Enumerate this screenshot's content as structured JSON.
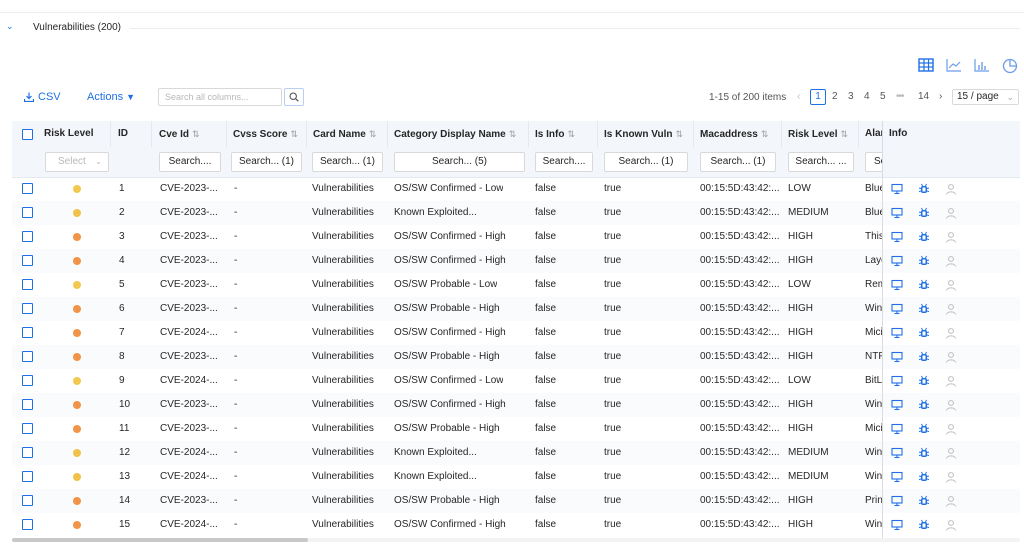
{
  "section": {
    "title": "Vulnerabilities (200)"
  },
  "view_icons": [
    "table-icon",
    "line-chart-icon",
    "bar-chart-icon",
    "pie-chart-icon"
  ],
  "toolbar": {
    "csv_label": "CSV",
    "actions_label": "Actions",
    "search_placeholder": "Search all columns...",
    "range_text": "1-15 of 200 items",
    "pages": [
      "1",
      "2",
      "3",
      "4",
      "5",
      "•••",
      "14"
    ],
    "active_page": "1",
    "page_size": "15 / page"
  },
  "colors": {
    "accent": "#1f6fe5",
    "low": "#f2c94c",
    "high": "#f0944a",
    "medium": "#f0c24a"
  },
  "columns": [
    "Risk Level",
    "ID",
    "Cve Id",
    "Cvss Score",
    "Card Name",
    "Category Display Name",
    "Is Info",
    "Is Known Vuln",
    "Macaddress",
    "Risk Level",
    "Alar",
    "Info"
  ],
  "filters": [
    "Select",
    "Search....",
    "Search... (1)",
    "Search... (1)",
    "Search... (5)",
    "Search....",
    "Search... (1)",
    "Search... (1)",
    "Search... ...",
    "Se"
  ],
  "rows": [
    {
      "id": "1",
      "cve": "CVE-2023-...",
      "cvss": "-",
      "card": "Vulnerabilities",
      "category": "OS/SW Confirmed - Low",
      "info": "false",
      "known": "true",
      "mac": "00:15:5D:43:42:...",
      "risk": "LOW",
      "alarm": "Blue",
      "dot": "low"
    },
    {
      "id": "2",
      "cve": "CVE-2023-...",
      "cvss": "-",
      "card": "Vulnerabilities",
      "category": "Known Exploited...",
      "info": "false",
      "known": "true",
      "mac": "00:15:5D:43:42:...",
      "risk": "MEDIUM",
      "alarm": "Blue",
      "dot": "medium"
    },
    {
      "id": "3",
      "cve": "CVE-2023-...",
      "cvss": "-",
      "card": "Vulnerabilities",
      "category": "OS/SW Confirmed - High",
      "info": "false",
      "known": "true",
      "mac": "00:15:5D:43:42:...",
      "risk": "HIGH",
      "alarm": "This",
      "dot": "high"
    },
    {
      "id": "4",
      "cve": "CVE-2023-...",
      "cvss": "-",
      "card": "Vulnerabilities",
      "category": "OS/SW Confirmed - High",
      "info": "false",
      "known": "true",
      "mac": "00:15:5D:43:42:...",
      "risk": "HIGH",
      "alarm": "Laye",
      "dot": "high"
    },
    {
      "id": "5",
      "cve": "CVE-2023-...",
      "cvss": "-",
      "card": "Vulnerabilities",
      "category": "OS/SW Probable - Low",
      "info": "false",
      "known": "true",
      "mac": "00:15:5D:43:42:...",
      "risk": "LOW",
      "alarm": "Rem",
      "dot": "low"
    },
    {
      "id": "6",
      "cve": "CVE-2023-...",
      "cvss": "-",
      "card": "Vulnerabilities",
      "category": "OS/SW Probable - High",
      "info": "false",
      "known": "true",
      "mac": "00:15:5D:43:42:...",
      "risk": "HIGH",
      "alarm": "Win",
      "dot": "high"
    },
    {
      "id": "7",
      "cve": "CVE-2024-...",
      "cvss": "-",
      "card": "Vulnerabilities",
      "category": "OS/SW Confirmed - High",
      "info": "false",
      "known": "true",
      "mac": "00:15:5D:43:42:...",
      "risk": "HIGH",
      "alarm": "Mici",
      "dot": "high"
    },
    {
      "id": "8",
      "cve": "CVE-2023-...",
      "cvss": "-",
      "card": "Vulnerabilities",
      "category": "OS/SW Probable - High",
      "info": "false",
      "known": "true",
      "mac": "00:15:5D:43:42:...",
      "risk": "HIGH",
      "alarm": "NTF",
      "dot": "high"
    },
    {
      "id": "9",
      "cve": "CVE-2024-...",
      "cvss": "-",
      "card": "Vulnerabilities",
      "category": "OS/SW Confirmed - Low",
      "info": "false",
      "known": "true",
      "mac": "00:15:5D:43:42:...",
      "risk": "LOW",
      "alarm": "BitL",
      "dot": "low"
    },
    {
      "id": "10",
      "cve": "CVE-2023-...",
      "cvss": "-",
      "card": "Vulnerabilities",
      "category": "OS/SW Confirmed - High",
      "info": "false",
      "known": "true",
      "mac": "00:15:5D:43:42:...",
      "risk": "HIGH",
      "alarm": "Win",
      "dot": "high"
    },
    {
      "id": "11",
      "cve": "CVE-2023-...",
      "cvss": "-",
      "card": "Vulnerabilities",
      "category": "OS/SW Probable - High",
      "info": "false",
      "known": "true",
      "mac": "00:15:5D:43:42:...",
      "risk": "HIGH",
      "alarm": "Mici",
      "dot": "high"
    },
    {
      "id": "12",
      "cve": "CVE-2024-...",
      "cvss": "-",
      "card": "Vulnerabilities",
      "category": "Known Exploited...",
      "info": "false",
      "known": "true",
      "mac": "00:15:5D:43:42:...",
      "risk": "MEDIUM",
      "alarm": "Win",
      "dot": "medium"
    },
    {
      "id": "13",
      "cve": "CVE-2024-...",
      "cvss": "-",
      "card": "Vulnerabilities",
      "category": "Known Exploited...",
      "info": "false",
      "known": "true",
      "mac": "00:15:5D:43:42:...",
      "risk": "MEDIUM",
      "alarm": "Win",
      "dot": "medium"
    },
    {
      "id": "14",
      "cve": "CVE-2023-...",
      "cvss": "-",
      "card": "Vulnerabilities",
      "category": "OS/SW Probable - High",
      "info": "false",
      "known": "true",
      "mac": "00:15:5D:43:42:...",
      "risk": "HIGH",
      "alarm": "Prin",
      "dot": "high"
    },
    {
      "id": "15",
      "cve": "CVE-2024-...",
      "cvss": "-",
      "card": "Vulnerabilities",
      "category": "OS/SW Confirmed - High",
      "info": "false",
      "known": "true",
      "mac": "00:15:5D:43:42:...",
      "risk": "HIGH",
      "alarm": "Win",
      "dot": "high"
    }
  ]
}
